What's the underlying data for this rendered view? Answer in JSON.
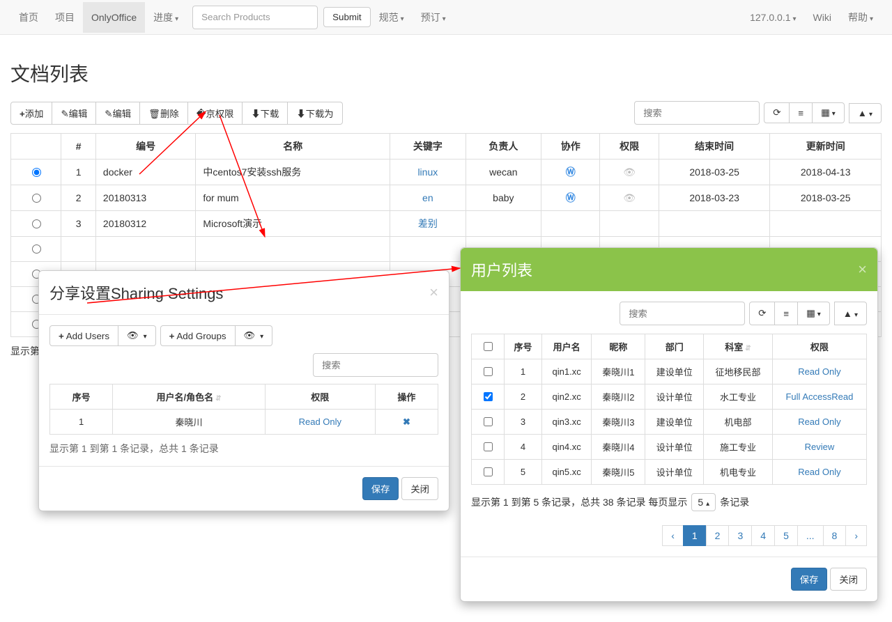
{
  "nav": {
    "items": [
      "首页",
      "项目",
      "OnlyOffice",
      "进度",
      "",
      "规范",
      "预订"
    ],
    "active_index": 2,
    "search_placeholder": "Search Products",
    "submit": "Submit",
    "right": {
      "ip": "127.0.0.1",
      "wiki": "Wiki",
      "help": "帮助"
    }
  },
  "page_title": "文档列表",
  "toolbar": {
    "add": "添加",
    "edit1": "编辑",
    "edit2": "编辑",
    "del": "删除",
    "perm": "权限",
    "download": "下载",
    "download_as": "下载为",
    "search_placeholder": "搜索"
  },
  "main_table": {
    "headers": [
      "",
      "#",
      "编号",
      "名称",
      "关键字",
      "负责人",
      "协作",
      "权限",
      "结束时间",
      "更新时间"
    ],
    "rows": [
      {
        "sel": true,
        "n": 1,
        "code": "docker",
        "name": "中centos7安装ssh服务",
        "kw": "linux",
        "owner": "wecan",
        "collab": "W",
        "perm_hidden": true,
        "end": "2018-03-25",
        "upd": "2018-04-13"
      },
      {
        "sel": false,
        "n": 2,
        "code": "20180313",
        "name": "for mum",
        "kw": "en",
        "owner": "baby",
        "collab": "W",
        "perm_hidden": true,
        "end": "2018-03-23",
        "upd": "2018-03-25"
      },
      {
        "sel": false,
        "n": 3,
        "code": "20180312",
        "name": "Microsoft演示",
        "kw": "差别",
        "owner": "",
        "collab": "",
        "perm_hidden": false,
        "end": "",
        "upd": ""
      },
      {
        "sel": false,
        "n": "",
        "code": "",
        "name": "",
        "kw": "",
        "owner": "",
        "collab": "",
        "perm_hidden": false,
        "end": "",
        "upd": ""
      },
      {
        "sel": false,
        "n": "",
        "code": "",
        "name": "",
        "kw": "",
        "owner": "",
        "collab": "",
        "perm_hidden": false,
        "end": "",
        "upd": ""
      },
      {
        "sel": false,
        "n": "",
        "code": "",
        "name": "",
        "kw": "",
        "owner": "",
        "collab": "",
        "perm_hidden": false,
        "end": "",
        "upd": ""
      },
      {
        "sel": false,
        "n": "",
        "code": "",
        "name": "",
        "kw": "",
        "owner": "",
        "collab": "",
        "perm_hidden": false,
        "end": "",
        "upd": ""
      }
    ],
    "footer": "显示第"
  },
  "sharing": {
    "title": "分享设置Sharing Settings",
    "add_users": "Add Users",
    "add_groups": "Add Groups",
    "search_placeholder": "搜索",
    "headers": [
      "序号",
      "用户名/角色名",
      "权限",
      "操作"
    ],
    "rows": [
      {
        "n": 1,
        "name": "秦晓川",
        "perm": "Read Only"
      }
    ],
    "info": "显示第 1 到第 1 条记录，总共 1 条记录",
    "save": "保存",
    "close": "关闭"
  },
  "userlist": {
    "title": "用户列表",
    "search_placeholder": "搜索",
    "headers": [
      "",
      "序号",
      "用户名",
      "昵称",
      "部门",
      "科室",
      "权限"
    ],
    "rows": [
      {
        "chk": false,
        "n": 1,
        "user": "qin1.xc",
        "nick": "秦晓川1",
        "dept": "建设单位",
        "sec": "征地移民部",
        "perm": "Read Only"
      },
      {
        "chk": true,
        "n": 2,
        "user": "qin2.xc",
        "nick": "秦晓川2",
        "dept": "设计单位",
        "sec": "水工专业",
        "perm": "Full AccessRead"
      },
      {
        "chk": false,
        "n": 3,
        "user": "qin3.xc",
        "nick": "秦晓川3",
        "dept": "建设单位",
        "sec": "机电部",
        "perm": "Read Only"
      },
      {
        "chk": false,
        "n": 4,
        "user": "qin4.xc",
        "nick": "秦晓川4",
        "dept": "设计单位",
        "sec": "施工专业",
        "perm": "Review"
      },
      {
        "chk": false,
        "n": 5,
        "user": "qin5.xc",
        "nick": "秦晓川5",
        "dept": "设计单位",
        "sec": "机电专业",
        "perm": "Read Only"
      }
    ],
    "records_text_a": "显示第 1 到第 5 条记录，总共 38 条记录 每页显示",
    "page_size": "5",
    "records_text_b": "条记录",
    "pages": [
      "‹",
      "1",
      "2",
      "3",
      "4",
      "5",
      "...",
      "8",
      "›"
    ],
    "active_page_index": 1,
    "save": "保存",
    "close": "关闭"
  }
}
